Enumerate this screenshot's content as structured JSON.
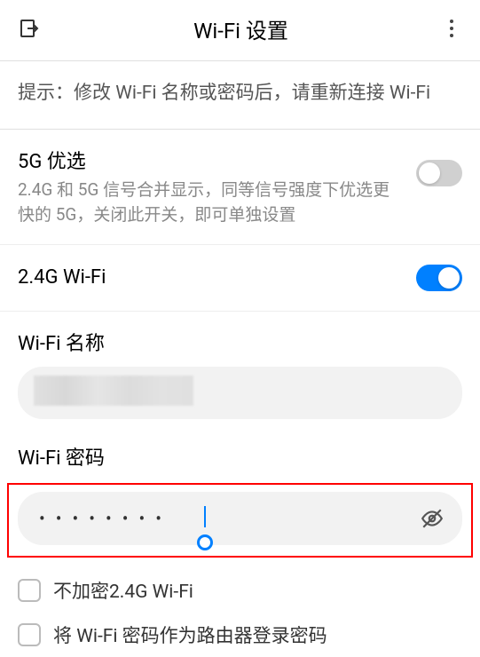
{
  "header": {
    "title": "Wi-Fi 设置"
  },
  "tip": {
    "text": "提示：修改 Wi-Fi 名称或密码后，请重新连接 Wi-Fi"
  },
  "prefer5g": {
    "title": "5G 优选",
    "desc": "2.4G 和 5G 信号合并显示，同等信号强度下优选更快的 5G，关闭此开关，即可单独设置",
    "enabled": false
  },
  "wifi24g": {
    "title": "2.4G Wi-Fi",
    "enabled": true
  },
  "nameField": {
    "label": "Wi-Fi 名称",
    "value": ""
  },
  "passwordField": {
    "label": "Wi-Fi 密码",
    "masked": "••••••••"
  },
  "checkboxes": {
    "noEncrypt": {
      "label": "不加密2.4G Wi-Fi",
      "checked": false
    },
    "useAsRouter": {
      "label": "将 Wi-Fi 密码作为路由器登录密码",
      "checked": false
    }
  }
}
